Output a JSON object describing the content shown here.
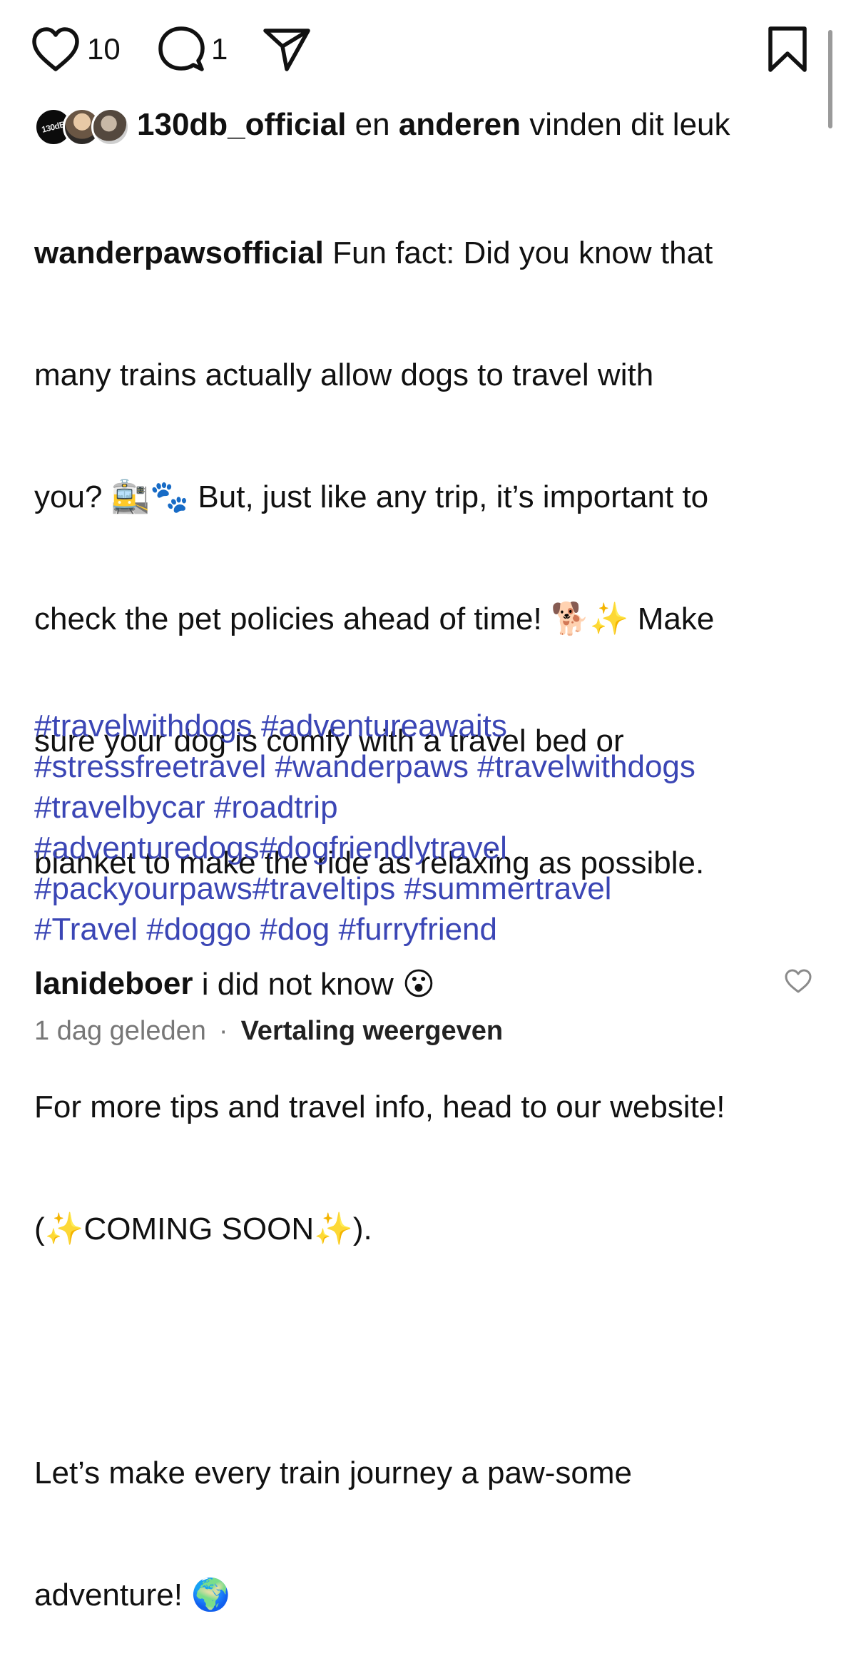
{
  "actions": {
    "like_count": "10",
    "comment_count": "1"
  },
  "likes": {
    "avatar1_text": "130dB",
    "first_user": "130db_official",
    "connector": " en ",
    "others": "anderen",
    "suffix": " vinden dit leuk"
  },
  "post": {
    "username": "wanderpawsofficial",
    "lines": [
      " Fun fact: Did you know that",
      "many trains actually allow dogs to travel with",
      "you? 🚉🐾 But, just like any trip, it’s important to",
      "check the pet policies ahead of time! 🐕✨ Make",
      "sure your dog is comfy with a travel bed or",
      "blanket to make the ride as relaxing as possible."
    ],
    "para2_lines": [
      "For more tips and travel info, head to our website!",
      "(✨COMING SOON✨)."
    ],
    "para3_lines": [
      "Let’s make every train journey a paw-some",
      "adventure! 🌍"
    ],
    "hashtag_lines": [
      "#travelwithdogs #adventureawaits",
      "#stressfreetravel #wanderpaws #travelwithdogs",
      "#travelbycar #roadtrip",
      "#adventuredogs#dogfriendlytravel",
      "#packyourpaws#traveltips #summertravel",
      "#Travel #doggo #dog #furryfriend"
    ]
  },
  "comment": {
    "username": "lanideboer",
    "text": " i did not know 😮"
  },
  "meta": {
    "time": "1 dag geleden",
    "separator": "·",
    "translate": "Vertaling weergeven"
  }
}
